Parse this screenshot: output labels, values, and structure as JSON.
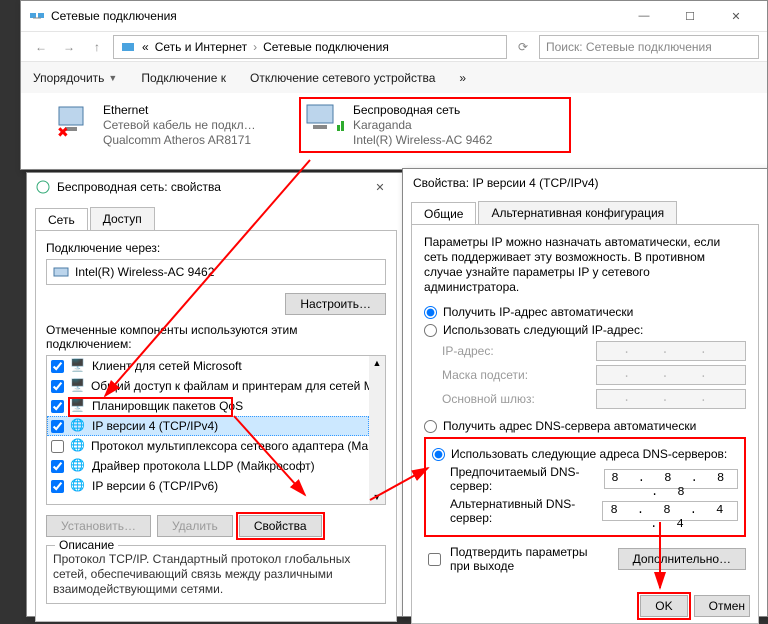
{
  "explorer": {
    "title": "Сетевые подключения",
    "crumb1": "Сеть и Интернет",
    "crumb2": "Сетевые подключения",
    "search_placeholder": "Поиск: Сетевые подключения",
    "cmd_organize": "Упорядочить",
    "cmd_connect": "Подключение к",
    "cmd_disable": "Отключение сетевого устройства",
    "cmd_more": "»",
    "adapters": [
      {
        "name": "Ethernet",
        "status": "Сетевой кабель не подкл…",
        "device": "Qualcomm Atheros AR8171"
      },
      {
        "name": "Беспроводная сеть",
        "status": "Karaganda",
        "device": "Intel(R) Wireless-AC 9462"
      }
    ]
  },
  "props": {
    "title": "Беспроводная сеть: свойства",
    "tab_net": "Сеть",
    "tab_access": "Доступ",
    "connect_via_label": "Подключение через:",
    "connect_via_value": "Intel(R) Wireless-AC 9462",
    "btn_configure": "Настроить…",
    "components_label": "Отмеченные компоненты используются этим подключением:",
    "items": [
      "Клиент для сетей Microsoft",
      "Общий доступ к файлам и принтерам для сетей Mi",
      "Планировщик пакетов QoS",
      "IP версии 4 (TCP/IPv4)",
      "Протокол мультиплексора сетевого адаптера (Май",
      "Драйвер протокола LLDP (Майкрософт)",
      "IP версии 6 (TCP/IPv6)"
    ],
    "btn_install": "Установить…",
    "btn_uninstall": "Удалить",
    "btn_props": "Свойства",
    "group_desc": "Описание",
    "desc": "Протокол TCP/IP. Стандартный протокол глобальных сетей, обеспечивающий связь между различными взаимодействующими сетями."
  },
  "ipv4": {
    "title": "Свойства: IP версии 4 (TCP/IPv4)",
    "tab_general": "Общие",
    "tab_alt": "Альтернативная конфигурация",
    "para": "Параметры IP можно назначать автоматически, если сеть поддерживает эту возможность. В противном случае узнайте параметры IP у сетевого администратора.",
    "r_ip_auto": "Получить IP-адрес автоматически",
    "r_ip_manual": "Использовать следующий IP-адрес:",
    "lbl_ip": "IP-адрес:",
    "lbl_mask": "Маска подсети:",
    "lbl_gw": "Основной шлюз:",
    "r_dns_auto": "Получить адрес DNS-сервера автоматически",
    "r_dns_manual": "Использовать следующие адреса DNS-серверов:",
    "lbl_dns1": "Предпочитаемый DNS-сервер:",
    "lbl_dns2": "Альтернативный DNS-сервер:",
    "dns1": "8 . 8 . 8 . 8",
    "dns2": "8 . 8 . 4 . 4",
    "chk_validate": "Подтвердить параметры при выходе",
    "btn_adv": "Дополнительно…",
    "btn_ok": "OK",
    "btn_cancel": "Отмен"
  }
}
